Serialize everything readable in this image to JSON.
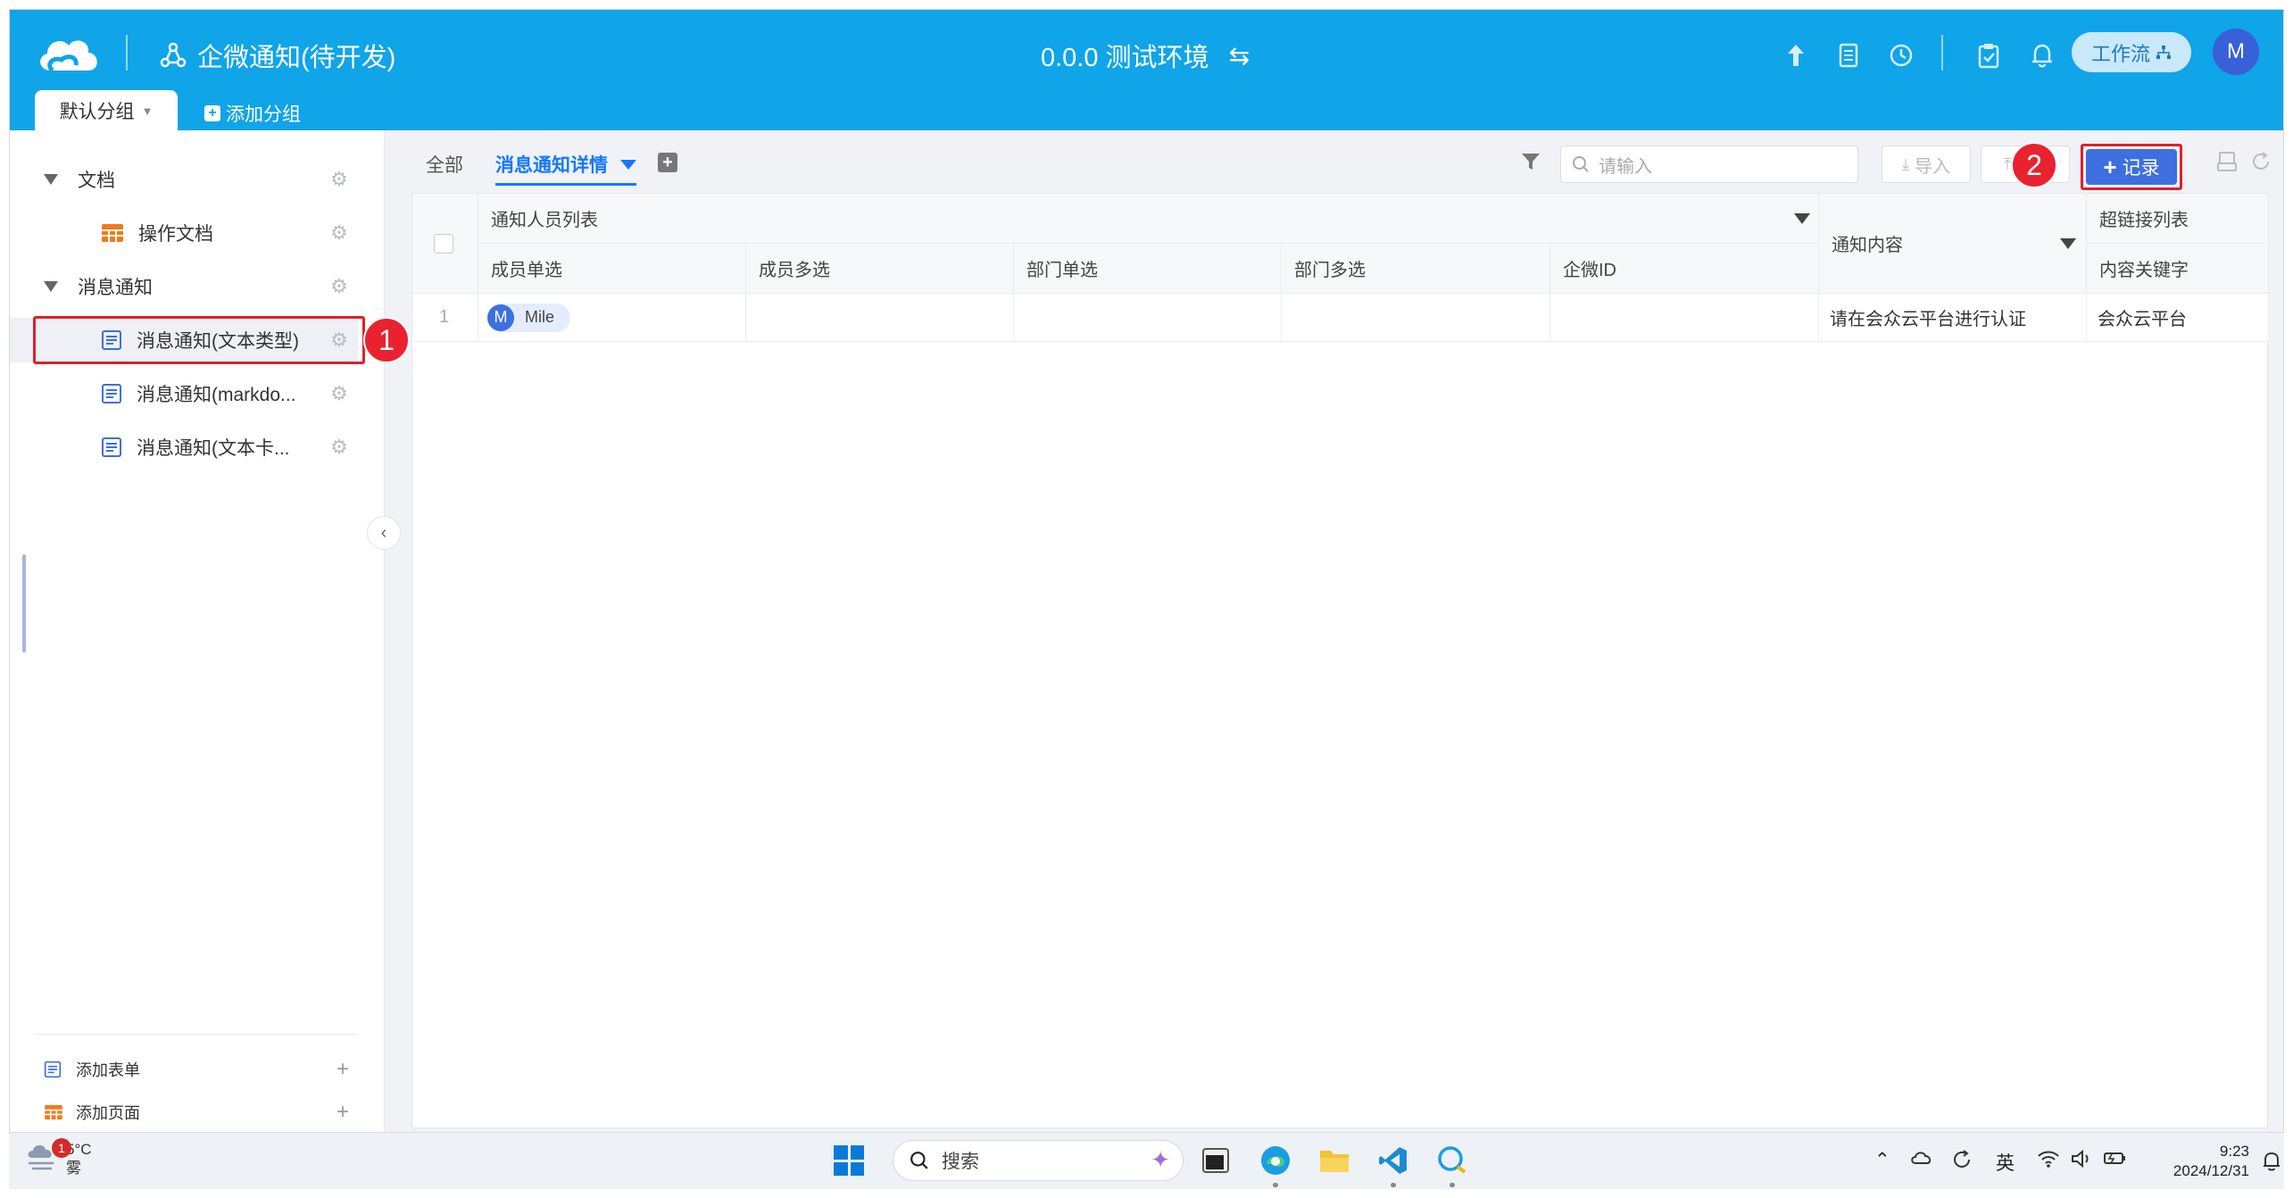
{
  "header": {
    "app_title": "企微通知(待开发)",
    "environment": "0.0.0 测试环境",
    "env_switch_icon": "⇆",
    "workflow_label": "工作流",
    "user_initial": "M"
  },
  "groups": {
    "active_group": "默认分组",
    "add_group": "添加分组"
  },
  "sidebar": {
    "folders": [
      {
        "label": "文档",
        "items": [
          {
            "label": "操作文档",
            "icon": "page-icon"
          }
        ]
      },
      {
        "label": "消息通知",
        "items": [
          {
            "label": "消息通知(文本类型)",
            "icon": "form-icon",
            "active": true
          },
          {
            "label": "消息通知(markdo...",
            "icon": "form-icon"
          },
          {
            "label": "消息通知(文本卡...",
            "icon": "form-icon"
          }
        ]
      }
    ],
    "add_form": "添加表单",
    "add_page": "添加页面"
  },
  "annotations": {
    "step1": "1",
    "step2": "2"
  },
  "toolbar": {
    "all_label": "全部",
    "view_label": "消息通知详情",
    "search_placeholder": "请输入",
    "import_label": "导入",
    "add_record_label": "记录"
  },
  "table": {
    "group_header": "通知人员列表",
    "columns": [
      "成员单选",
      "成员多选",
      "部门单选",
      "部门多选",
      "企微ID"
    ],
    "content_column": "通知内容",
    "link_group_header": "超链接列表",
    "link_column": "内容关键字",
    "rows": [
      {
        "index": "1",
        "member_single": {
          "initial": "M",
          "name": "Mile"
        },
        "member_multi": "",
        "dept_single": "",
        "dept_multi": "",
        "wecom_id": "",
        "content": "请在会众云平台进行认证",
        "keyword": "会众云平台"
      }
    ]
  },
  "taskbar": {
    "weather_temp": "5°C",
    "weather_desc": "雾",
    "weather_badge": "1",
    "search_label": "搜索",
    "ime": "英",
    "time": "9:23",
    "date": "2024/12/31"
  },
  "colors": {
    "header_bg": "#10a4e8",
    "accent": "#3e6fe0",
    "annotation_red": "#e0202a"
  }
}
